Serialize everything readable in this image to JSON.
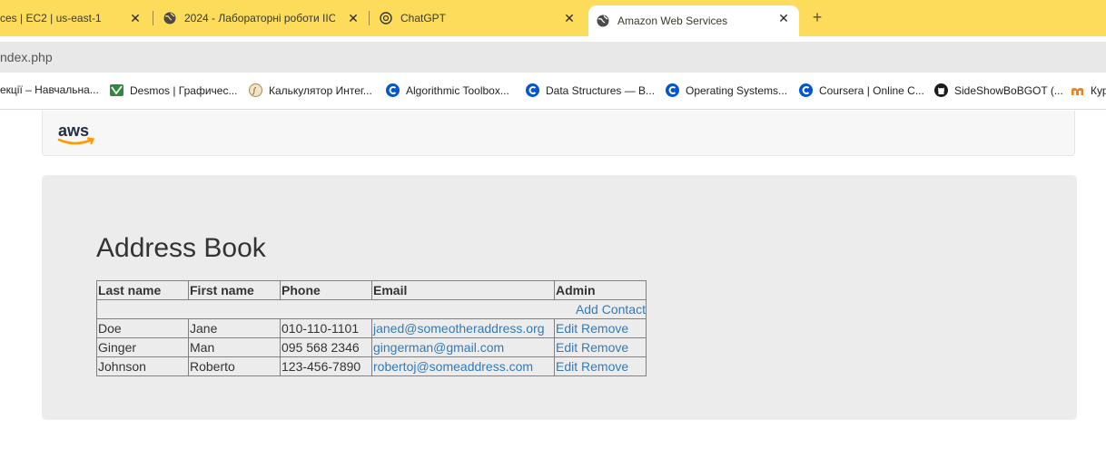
{
  "browser": {
    "tabs": [
      {
        "title": "ces | EC2 | us-east-1",
        "active": false
      },
      {
        "title": "2024 - Лабораторні роботи ІІС",
        "active": false
      },
      {
        "title": "ChatGPT",
        "active": false
      },
      {
        "title": "Amazon Web Services",
        "active": true
      }
    ],
    "new_tab_symbol": "+",
    "close_symbol": "✕",
    "url": "ndex.php",
    "bookmarks": [
      {
        "label": "екції – Навчальна...",
        "icon": "moodle-icon"
      },
      {
        "label": "Desmos | Графичес...",
        "icon": "desmos-icon"
      },
      {
        "label": "Калькулятор Интег...",
        "icon": "calculator-icon"
      },
      {
        "label": "Algorithmic Toolbox...",
        "icon": "coursera-icon"
      },
      {
        "label": "Data Structures — B...",
        "icon": "coursera-icon"
      },
      {
        "label": "Operating Systems...",
        "icon": "coursera-icon"
      },
      {
        "label": "Coursera | Online C...",
        "icon": "coursera-icon"
      },
      {
        "label": "SideShowBoBGOT (...",
        "icon": "github-icon"
      },
      {
        "label": "Кур",
        "icon": "moodle-icon"
      }
    ]
  },
  "page": {
    "logo_text": "aws",
    "title": "Address Book",
    "table": {
      "headers": [
        "Last name",
        "First name",
        "Phone",
        "Email",
        "Admin"
      ],
      "add_contact": "Add Contact",
      "rows": [
        {
          "last": "Doe",
          "first": "Jane",
          "phone": "010-110-1101",
          "email": "janed@someotheraddress.org",
          "edit": "Edit",
          "remove": "Remove"
        },
        {
          "last": "Ginger",
          "first": "Man",
          "phone": "095 568 2346",
          "email": "gingerman@gmail.com",
          "edit": "Edit",
          "remove": "Remove"
        },
        {
          "last": "Johnson",
          "first": "Roberto",
          "phone": "123-456-7890",
          "email": "robertoj@someaddress.com",
          "edit": "Edit",
          "remove": "Remove"
        }
      ]
    }
  },
  "colors": {
    "tabstrip": "#fddc5c",
    "link": "#337ab7",
    "jumbotron": "#ececec",
    "aws_orange": "#ff9900"
  }
}
